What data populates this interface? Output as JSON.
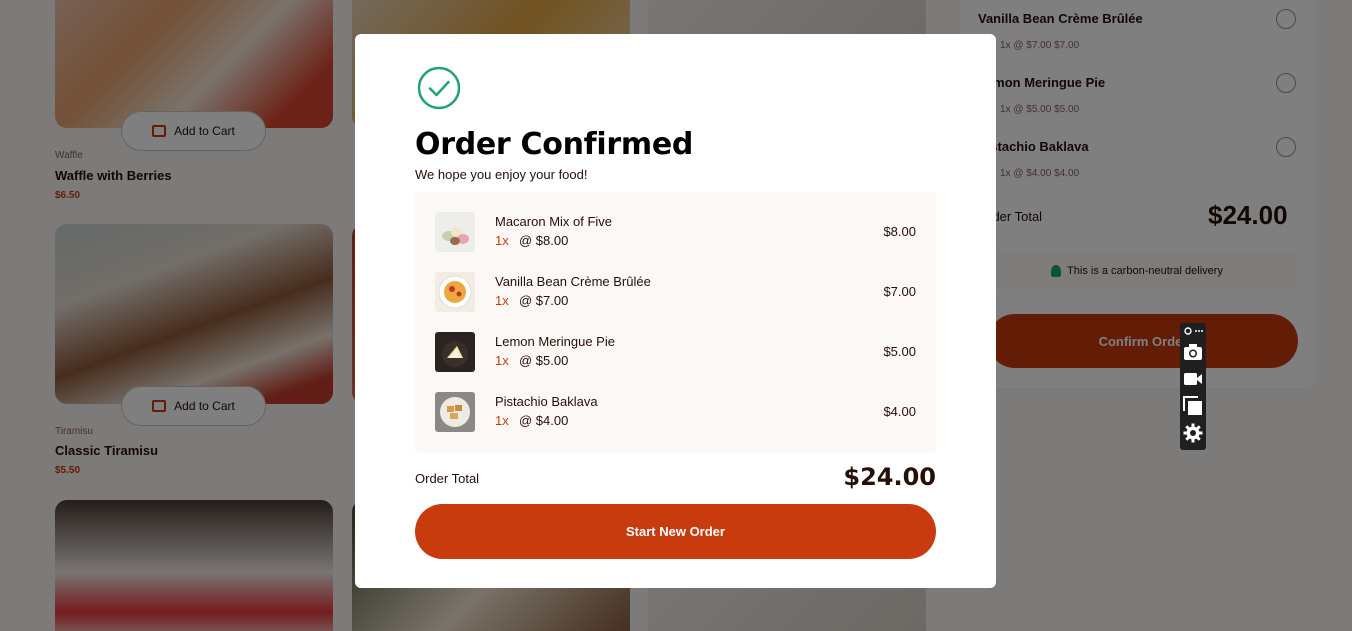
{
  "background": {
    "products": [
      {
        "category": "Waffle",
        "name": "Waffle with Berries",
        "price": "$6.50",
        "add_label": "Add to Cart"
      },
      {
        "category": "Tiramisu",
        "name": "Classic Tiramisu",
        "price": "$5.50",
        "add_label": "Add to Cart"
      }
    ],
    "cart": {
      "items": [
        {
          "name": "Vanilla Bean Crème Brûlée",
          "detail": "1x  @ $7.00  $7.00"
        },
        {
          "name": "Lemon Meringue Pie",
          "detail": "1x  @ $5.00  $5.00"
        },
        {
          "name": "Pistachio Baklava",
          "detail": "1x  @ $4.00  $4.00"
        }
      ],
      "total_label": "Order Total",
      "total_value": "$24.00",
      "carbon_text": "This is a carbon-neutral delivery",
      "confirm_label": "Confirm Order"
    }
  },
  "modal": {
    "title": "Order Confirmed",
    "subtitle": "We hope you enjoy your food!",
    "items": [
      {
        "name": "Macaron Mix of Five",
        "qty": "1x",
        "unit": "@ $8.00",
        "total": "$8.00",
        "thumb": "macaron"
      },
      {
        "name": "Vanilla Bean Crème Brûlée",
        "qty": "1x",
        "unit": "@ $7.00",
        "total": "$7.00",
        "thumb": "creme-brulee"
      },
      {
        "name": "Lemon Meringue Pie",
        "qty": "1x",
        "unit": "@ $5.00",
        "total": "$5.00",
        "thumb": "lemon-pie"
      },
      {
        "name": "Pistachio Baklava",
        "qty": "1x",
        "unit": "@ $4.00",
        "total": "$4.00",
        "thumb": "baklava"
      }
    ],
    "total_label": "Order Total",
    "total_value": "$24.00",
    "button_label": "Start New Order"
  },
  "toolbar": {
    "icons": [
      "link-icon",
      "camera-icon",
      "video-icon",
      "copy-icon",
      "gear-icon"
    ]
  },
  "colors": {
    "accent": "#c73b0f",
    "check": "#1ea475",
    "text": "#260f08",
    "panel": "#fcf8f6"
  }
}
